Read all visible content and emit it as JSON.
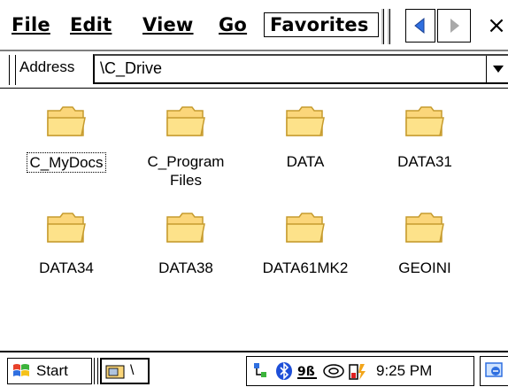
{
  "menu": {
    "file": "File",
    "edit": "Edit",
    "view": "View",
    "go": "Go",
    "favorites": "Favorites",
    "close": "×"
  },
  "address": {
    "label": "Address",
    "value": "\\C_Drive"
  },
  "files": [
    {
      "name": "C_MyDocs",
      "icon": "folder-icon"
    },
    {
      "name": "C_Program Files",
      "icon": "folder-icon"
    },
    {
      "name": "DATA",
      "icon": "folder-icon"
    },
    {
      "name": "DATA31",
      "icon": "folder-icon"
    },
    {
      "name": "DATA34",
      "icon": "folder-icon"
    },
    {
      "name": "DATA38",
      "icon": "folder-icon"
    },
    {
      "name": "DATA61MK2",
      "icon": "folder-icon"
    },
    {
      "name": "GEOINI",
      "icon": "folder-icon"
    }
  ],
  "taskbar": {
    "start_label": "Start",
    "task_label": "\\",
    "clock": "9:25 PM"
  },
  "colors": {
    "folder_fill": "#fde28a",
    "folder_stroke": "#c69b2e",
    "nav_arrow_active": "#2f6fe0",
    "nav_arrow_inactive": "#a9a9a9"
  }
}
